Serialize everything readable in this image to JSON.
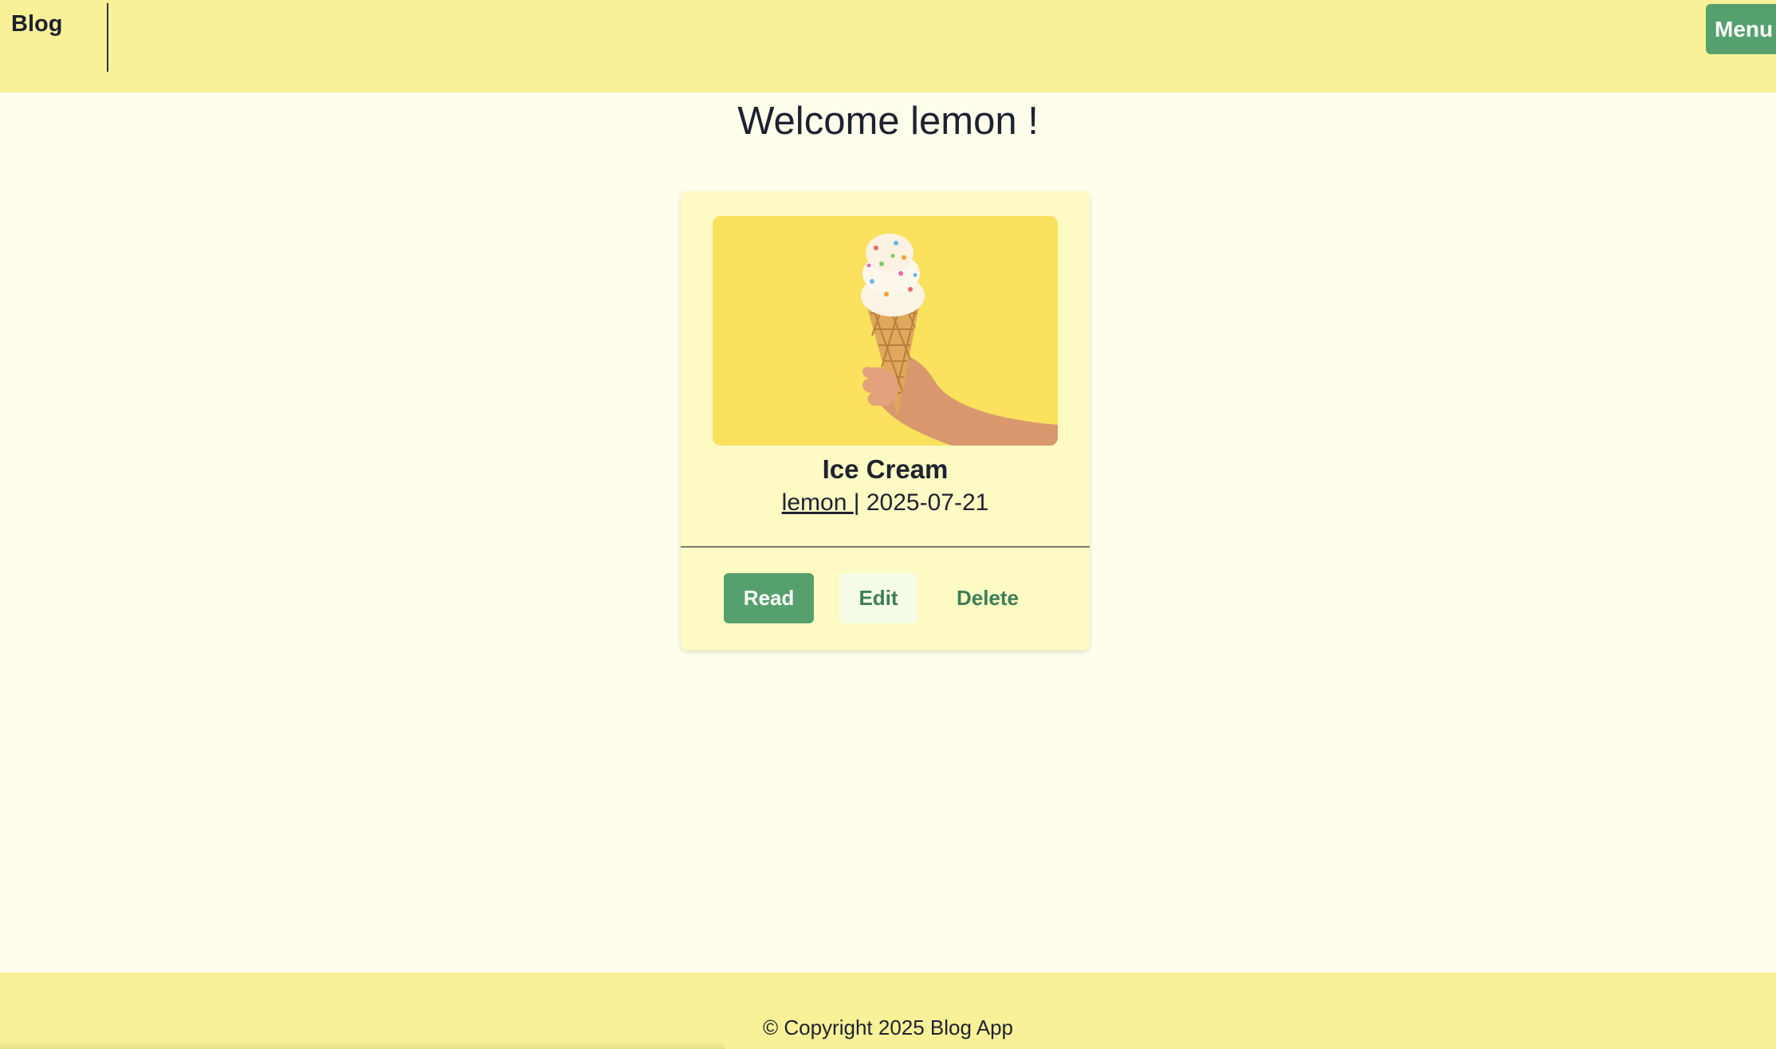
{
  "header": {
    "brand": "Blog",
    "menu_label": "Menu"
  },
  "welcome": {
    "text": "Welcome lemon !"
  },
  "post": {
    "title": "Ice Cream",
    "author": "lemon ",
    "separator": "|",
    "date": "2025-07-21",
    "image_icon": "ice-cream-cone-image",
    "actions": {
      "read": "Read",
      "edit": "Edit",
      "delete": "Delete"
    }
  },
  "footer": {
    "copyright": "© Copyright 2025 Blog App"
  },
  "colors": {
    "header_bg": "#f8f198",
    "page_bg": "#fffeec",
    "card_bg": "#fefac4",
    "primary_green": "#55a06d",
    "text_green": "#3e7d56",
    "image_bg": "#fae15e"
  }
}
